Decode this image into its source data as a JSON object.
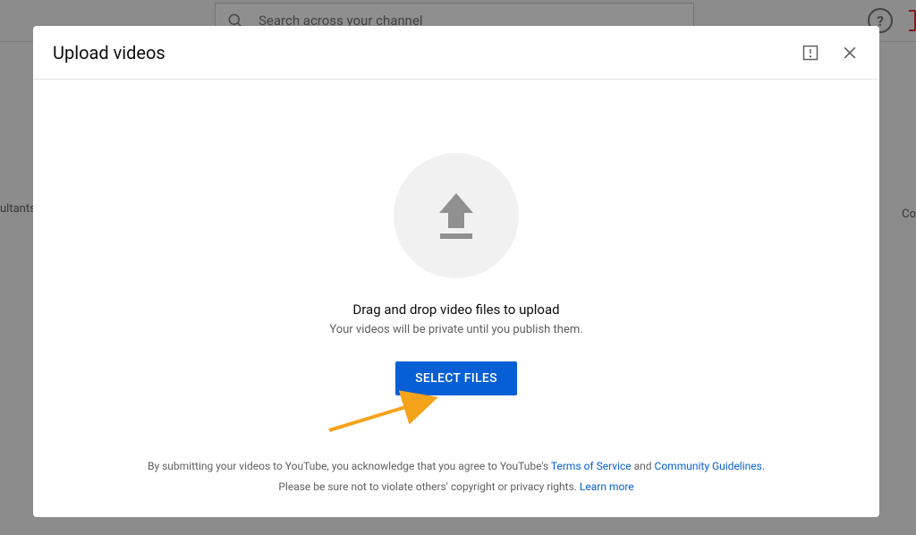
{
  "search": {
    "placeholder": "Search across your channel"
  },
  "left_fragment": "ultants",
  "right_fragment": "Co",
  "modal": {
    "title": "Upload videos",
    "drag_line": "Drag and drop video files to upload",
    "private_line": "Your videos will be private until you publish them.",
    "select_button": "SELECT FILES",
    "footer": {
      "pre": "By submitting your videos to YouTube, you acknowledge that you agree to YouTube's ",
      "tos": "Terms of Service",
      "and": " and ",
      "guidelines": "Community Guidelines",
      "period": ".",
      "line2_pre": "Please be sure not to violate others' copyright or privacy rights. ",
      "learn": "Learn more"
    }
  }
}
